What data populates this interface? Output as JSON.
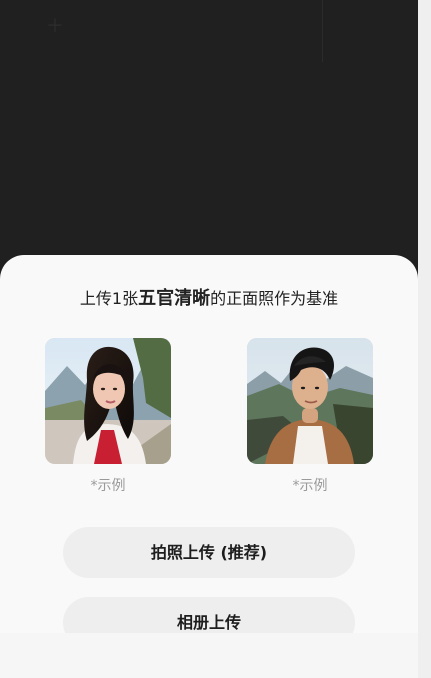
{
  "upload_sheet": {
    "title_prefix": "上传1张",
    "title_emphasis": "五官清晰",
    "title_suffix": "的正面照作为基准",
    "sample_caption": "*示例",
    "buttons": {
      "camera": "拍照上传 (推荐)",
      "album": "相册上传"
    }
  },
  "colors": {
    "background": "#202020",
    "sheet": "#f9f9f9",
    "button": "#eeeeee",
    "caption": "#9a9a9a"
  },
  "icons": {
    "top_left": "plus-icon"
  }
}
